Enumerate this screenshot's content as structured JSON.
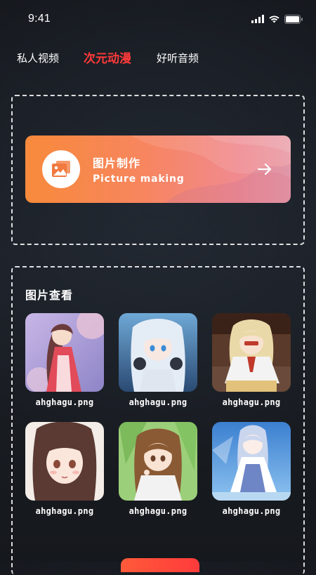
{
  "status_bar": {
    "time": "9:41",
    "icons": [
      "signal-icon",
      "wifi-icon",
      "battery-icon"
    ]
  },
  "tabs": [
    {
      "label": "私人视频",
      "active": false
    },
    {
      "label": "次元动漫",
      "active": true
    },
    {
      "label": "好听音频",
      "active": false
    }
  ],
  "colors": {
    "accent": "#ff3a3a",
    "card_gradient_start": "#f78a3b",
    "card_gradient_end": "#e89aa5",
    "background": "#181b20"
  },
  "make_card": {
    "icon": "image-icon",
    "title": "图片制作",
    "subtitle": "Picture making",
    "arrow_icon": "arrow-right-icon"
  },
  "gallery": {
    "title": "图片查看",
    "items": [
      {
        "label": "ahghagu.png"
      },
      {
        "label": "ahghagu.png"
      },
      {
        "label": "ahghagu.png"
      },
      {
        "label": "ahghagu.png"
      },
      {
        "label": "ahghagu.png"
      },
      {
        "label": "ahghagu.png"
      }
    ]
  }
}
